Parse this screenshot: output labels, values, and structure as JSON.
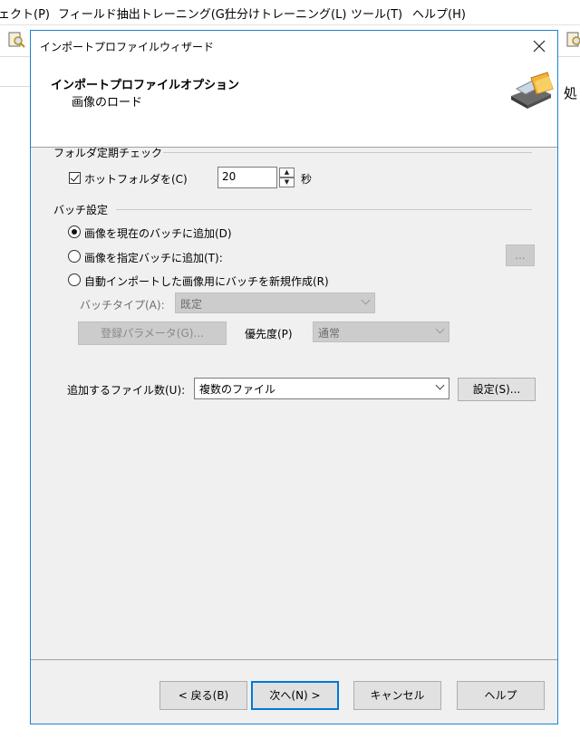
{
  "app": {
    "menu": [
      "ェクト(P)",
      "フィールド抽出トレーニング(G)",
      "仕分けトレーニング(L)",
      "ツール(T)",
      "ヘルプ(H)"
    ],
    "side_text": "処"
  },
  "dialog": {
    "title": "インポートプロファイルウィザード",
    "header_title": "インポートプロファイルオプション",
    "header_subtitle": "画像のロード",
    "folder_group": {
      "label": "フォルダ定期チェック",
      "hotfolder_label": "ホットフォルダを(C)",
      "hotfolder_checked": true,
      "interval_value": "20",
      "interval_unit": "秒"
    },
    "batch_group": {
      "label": "バッチ設定",
      "options": [
        {
          "label": "画像を現在のバッチに追加(D)",
          "selected": true
        },
        {
          "label": "画像を指定バッチに追加(T):",
          "selected": false
        },
        {
          "label": "自動インポートした画像用にバッチを新規作成(R)",
          "selected": false
        }
      ],
      "browse_label": "...",
      "batch_type_label": "バッチタイプ(A):",
      "batch_type_value": "既定",
      "register_params_label": "登録パラメータ(G)...",
      "priority_label": "優先度(P)",
      "priority_value": "通常"
    },
    "files_label": "追加するファイル数(U):",
    "files_value": "複数のファイル",
    "settings_label": "設定(S)...",
    "buttons": {
      "back": "< 戻る(B)",
      "next": "次へ(N) >",
      "cancel": "キャンセル",
      "help": "ヘルプ"
    }
  }
}
